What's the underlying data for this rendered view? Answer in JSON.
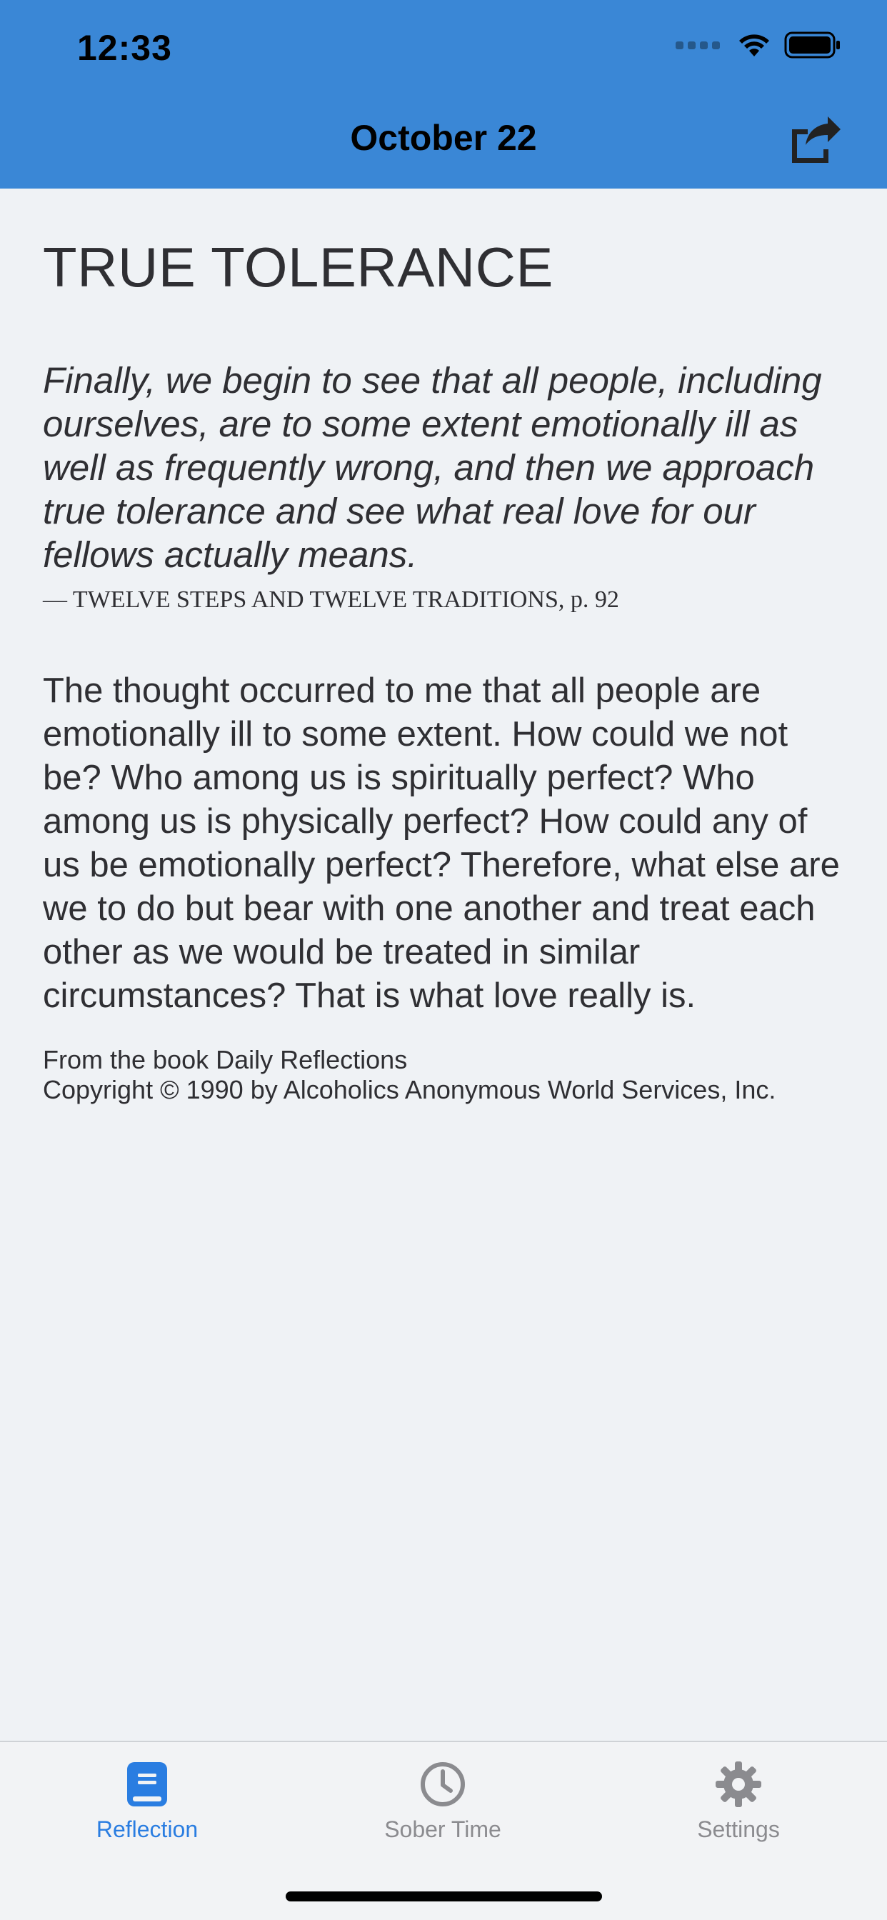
{
  "status_bar": {
    "time": "12:33"
  },
  "nav": {
    "title": "October 22",
    "share_icon": "share-icon"
  },
  "reflection": {
    "title": "TRUE TOLERANCE",
    "quote": "Finally, we begin to see that all people, including ourselves, are to some extent emotionally ill as well as frequently wrong, and then we approach true tolerance and see what real love for our fellows actually means.",
    "source": "— TWELVE STEPS AND TWELVE TRADITIONS, p. 92",
    "body": "The thought occurred to me that all people are emotionally ill to some extent. How could we not be? Who among us is spiritually perfect? Who among us is physically perfect? How could any of us be emotionally perfect? Therefore, what else are we to do but bear with one another and treat each other as we would be treated in similar circumstances? That is what love really is.",
    "footnote_line1": "From the book Daily Reflections",
    "footnote_line2": "Copyright © 1990 by Alcoholics Anonymous World Services, Inc."
  },
  "tabbar": {
    "tabs": [
      {
        "label": "Reflection",
        "icon": "book-icon",
        "active": true
      },
      {
        "label": "Sober Time",
        "icon": "clock-icon",
        "active": false
      },
      {
        "label": "Settings",
        "icon": "gear-icon",
        "active": false
      }
    ]
  },
  "colors": {
    "header_bg": "#3a87d6",
    "page_bg": "#eff2f5",
    "active_tab": "#2a7de1",
    "inactive_tab": "#8b8b8f"
  }
}
